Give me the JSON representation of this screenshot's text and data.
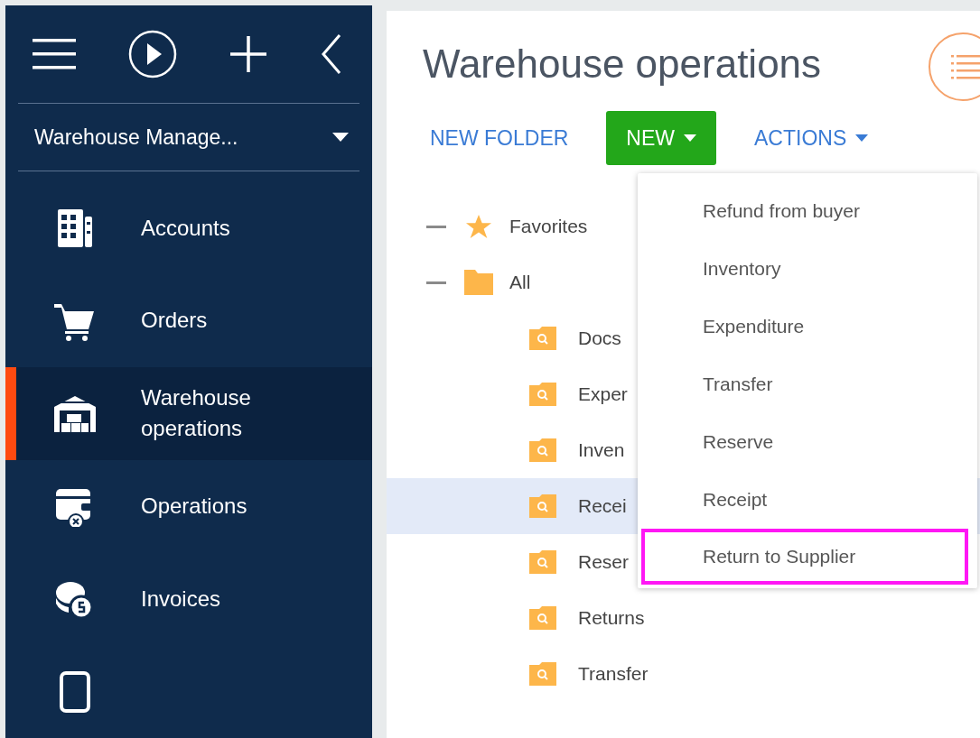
{
  "sidebar": {
    "workspace": {
      "label": "Warehouse Manage..."
    },
    "items": [
      {
        "label": "Accounts",
        "selected": false
      },
      {
        "label": "Orders",
        "selected": false
      },
      {
        "label": "Warehouse operations",
        "selected": true
      },
      {
        "label": "Operations",
        "selected": false
      },
      {
        "label": "Invoices",
        "selected": false
      }
    ]
  },
  "page": {
    "title": "Warehouse operations"
  },
  "toolbar": [
    {
      "label": "NEW FOLDER",
      "kind": "link"
    },
    {
      "label": "NEW",
      "kind": "primary-dropdown"
    },
    {
      "label": "ACTIONS",
      "kind": "dropdown"
    }
  ],
  "tree": [
    {
      "label": "Favorites",
      "kind": "favorites",
      "expanded": true,
      "selected": false
    },
    {
      "label": "All",
      "kind": "folder",
      "expanded": true,
      "selected": false,
      "children": [
        {
          "label": "Docs",
          "selected": false
        },
        {
          "label": "Exper",
          "selected": false
        },
        {
          "label": "Inven",
          "selected": false
        },
        {
          "label": "Recei",
          "selected": true
        },
        {
          "label": "Reser",
          "selected": false
        },
        {
          "label": "Returns",
          "selected": false
        },
        {
          "label": "Transfer",
          "selected": false
        }
      ]
    }
  ],
  "new_menu": [
    {
      "label": "Refund from buyer",
      "highlighted": false
    },
    {
      "label": "Inventory",
      "highlighted": false
    },
    {
      "label": "Expenditure",
      "highlighted": false
    },
    {
      "label": "Transfer",
      "highlighted": false
    },
    {
      "label": "Reserve",
      "highlighted": false
    },
    {
      "label": "Receipt",
      "highlighted": false
    },
    {
      "label": "Return to Supplier",
      "highlighted": true
    }
  ]
}
